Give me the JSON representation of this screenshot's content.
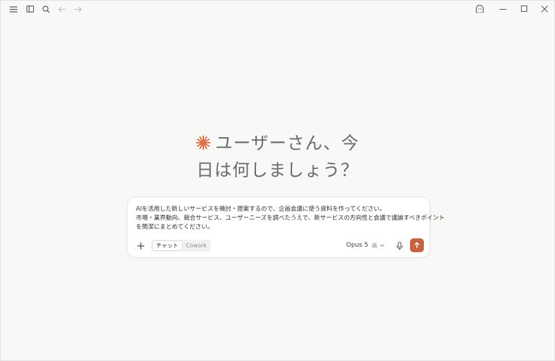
{
  "titlebar": {
    "icons": [
      "menu-icon",
      "sidebar-toggle-icon",
      "search-icon",
      "back-arrow-icon",
      "forward-arrow-icon",
      "ghost-mode-icon",
      "minimize-icon",
      "maximize-icon",
      "close-icon"
    ]
  },
  "greeting": {
    "line1": "ユーザーさん、今",
    "line2": "日は何しましょう？",
    "accent_color": "#d9724a"
  },
  "composer": {
    "text_lines": [
      "AIを活用した新しいサービスを検討・提案するので、企画会議に使う資料を作ってください。",
      "市場・業界動向、競合サービス、ユーザーニーズを調べたうえで、新サービスの方向性と会議で議論すべきポイント",
      "を簡潔にまとめてください。"
    ],
    "modes": [
      "チャット",
      "Cowork"
    ],
    "active_mode": "チャット",
    "model": "Opus 5",
    "effort": "高",
    "send_color": "#c4633f"
  }
}
